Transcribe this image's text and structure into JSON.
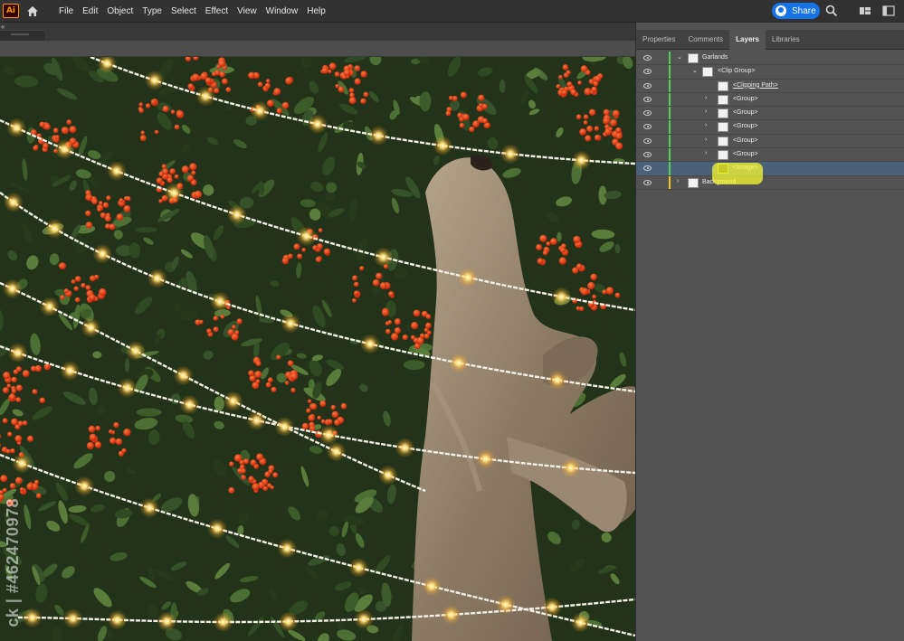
{
  "app": {
    "logo_text": "Ai",
    "menu": [
      "File",
      "Edit",
      "Object",
      "Type",
      "Select",
      "Effect",
      "View",
      "Window",
      "Help"
    ],
    "share_label": "Share"
  },
  "tabstrip": {
    "collapse_glyph": "«"
  },
  "panel": {
    "tabs": [
      "Properties",
      "Comments",
      "Layers",
      "Libraries"
    ],
    "active_tab": "Layers",
    "layers": [
      {
        "name": "Garlands",
        "twirl": "⌄",
        "bar": "green"
      },
      {
        "name": "<Clip Group>",
        "twirl": "⌄",
        "bar": "green"
      },
      {
        "name": "<Clipping Path>",
        "twirl": "",
        "bar": "green"
      },
      {
        "name": "<Group>",
        "twirl": "›",
        "bar": "green"
      },
      {
        "name": "<Group>",
        "twirl": "›",
        "bar": "green"
      },
      {
        "name": "<Group>",
        "twirl": "›",
        "bar": "green"
      },
      {
        "name": "<Group>",
        "twirl": "›",
        "bar": "green"
      },
      {
        "name": "<Group>",
        "twirl": "›",
        "bar": "green"
      },
      {
        "name": "<Image>",
        "twirl": "",
        "bar": "green",
        "selected": true
      },
      {
        "name": "Background",
        "twirl": "›",
        "bar": "yellow"
      }
    ]
  },
  "canvas": {
    "watermark": "ck | #462470978"
  },
  "colors": {
    "accent": "#1473e6",
    "layer_green": "#4fd24f",
    "layer_yellow": "#f3c623",
    "selection": "#4b6079",
    "highlight": "#ffff33"
  }
}
